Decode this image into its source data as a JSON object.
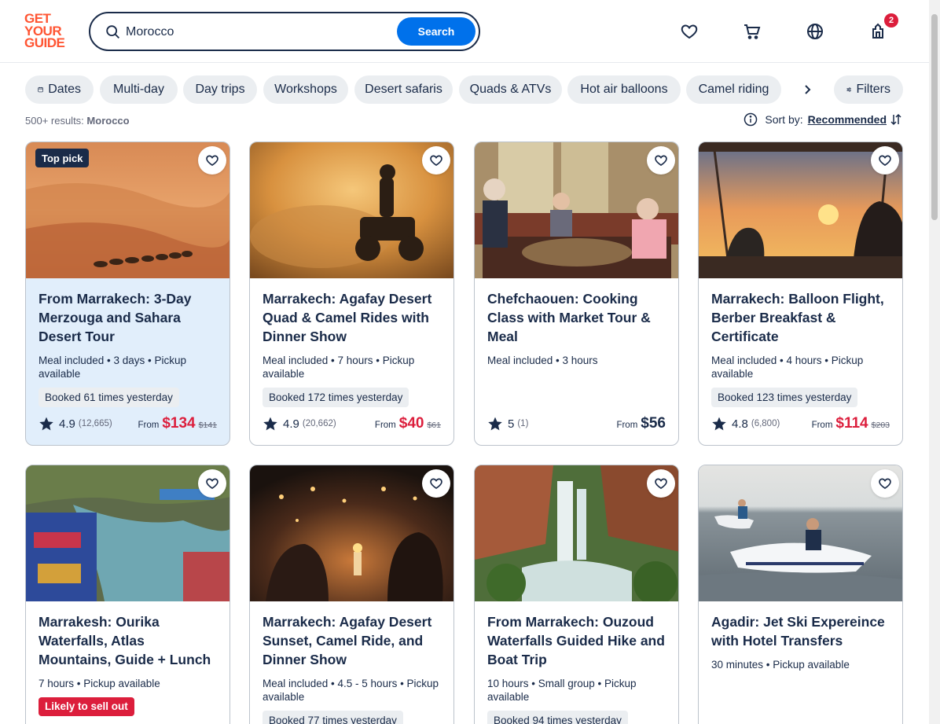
{
  "header": {
    "logo_lines": [
      "GET",
      "YOUR",
      "GUIDE"
    ],
    "search_value": "Morocco",
    "search_button": "Search",
    "cart_count": "2"
  },
  "chips": [
    {
      "label": "Dates",
      "icon": "calendar-icon"
    },
    {
      "label": "Multi-day"
    },
    {
      "label": "Day trips"
    },
    {
      "label": "Workshops"
    },
    {
      "label": "Desert safaris"
    },
    {
      "label": "Quads & ATVs"
    },
    {
      "label": "Hot air balloons"
    },
    {
      "label": "Camel riding"
    }
  ],
  "filters_label": "Filters",
  "results": {
    "count": "500+ results:",
    "query": "Morocco"
  },
  "sort": {
    "label": "Sort by:",
    "value": "Recommended"
  },
  "cards": [
    {
      "badge": "Top pick",
      "title": "From Marrakech: 3-Day Merzouga and Sahara Desert Tour",
      "meta": "Meal included • 3 days • Pickup available",
      "tag": "Booked 61 times yesterday",
      "rating": "4.9",
      "reviews": "(12,665)",
      "from": "From",
      "price": "$134",
      "old_price": "$141"
    },
    {
      "title": "Marrakech: Agafay Desert Quad & Camel Rides with Dinner Show",
      "meta": "Meal included • 7 hours • Pickup available",
      "tag": "Booked 172 times yesterday",
      "rating": "4.9",
      "reviews": "(20,662)",
      "from": "From",
      "price": "$40",
      "old_price": "$61"
    },
    {
      "title": "Chefchaouen: Cooking Class with Market Tour & Meal",
      "meta": "Meal included • 3 hours",
      "rating": "5",
      "reviews": "(1)",
      "from": "From",
      "price": "$56"
    },
    {
      "title": "Marrakech: Balloon Flight, Berber Breakfast & Certificate",
      "meta": "Meal included • 4 hours • Pickup available",
      "tag": "Booked 123 times yesterday",
      "rating": "4.8",
      "reviews": "(6,800)",
      "from": "From",
      "price": "$114",
      "old_price": "$203"
    },
    {
      "title": "Marrakesh: Ourika Waterfalls, Atlas Mountains, Guide + Lunch",
      "meta": "7 hours • Pickup available",
      "alert": "Likely to sell out"
    },
    {
      "title": "Marrakech: Agafay Desert Sunset, Camel Ride, and Dinner Show",
      "meta": "Meal included • 4.5 - 5 hours • Pickup available",
      "tag": "Booked 77 times yesterday"
    },
    {
      "title": "From Marrakech: Ouzoud Waterfalls Guided Hike and Boat Trip",
      "meta": "10 hours • Small group • Pickup available",
      "tag": "Booked 94 times yesterday"
    },
    {
      "title": "Agadir: Jet Ski Expereince with Hotel Transfers",
      "meta": "30 minutes • Pickup available"
    }
  ],
  "colors": {
    "brand": "#ff5533",
    "primary": "#0071eb",
    "navy": "#1a2b49",
    "sale": "#dc1e3c"
  }
}
